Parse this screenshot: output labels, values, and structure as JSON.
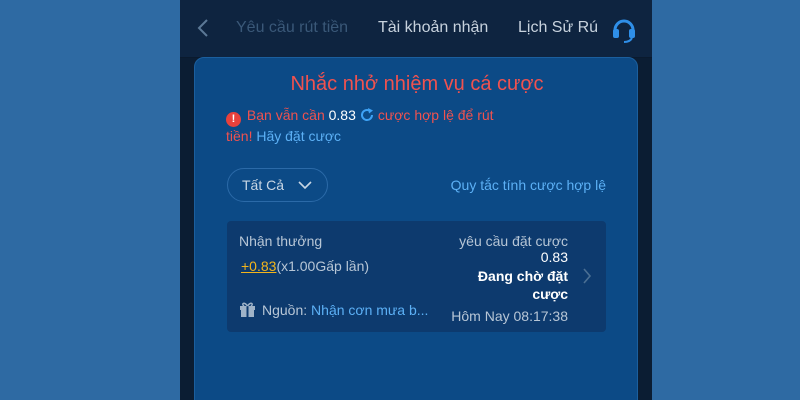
{
  "header": {
    "tabs": [
      {
        "label": "Yêu cầu rút tiền"
      },
      {
        "label": "Tài khoản nhận"
      },
      {
        "label": "Lịch Sử Rú"
      }
    ]
  },
  "dialog": {
    "title": "Nhắc nhở nhiệm vụ cá cược",
    "warning": {
      "prefix": "Bạn vẫn cần",
      "amount": "0.83",
      "suffix": "cược hợp lệ để rút tiền!",
      "link": "Hãy đặt cược"
    },
    "filter": {
      "selected": "Tất Cả"
    },
    "rules_link": "Quy tắc tính cược hợp lệ",
    "record": {
      "reward_label": "Nhận thưởng",
      "reward_amount": "+0.83",
      "reward_multiplier": "(x1.00Gấp lần)",
      "source_label": "Nguồn:",
      "source_value": "Nhận cơn mưa b...",
      "requirement_label": "yêu cầu đặt cược",
      "requirement_value": "0.83",
      "status": "Đang chờ đặt cược",
      "timestamp": "Hôm Nay 08:17:38"
    }
  },
  "colors": {
    "background": "#2e6aa3",
    "dialog": "#0c4a86",
    "card": "#0d3a6e",
    "title": "#f0524f",
    "link": "#5cb0f5",
    "reward": "#f3b51c"
  }
}
